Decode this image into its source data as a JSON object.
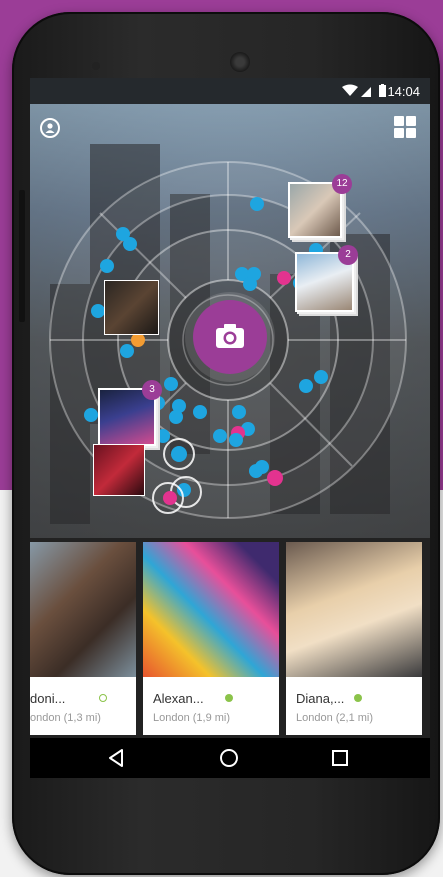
{
  "status_bar": {
    "time": "14:04"
  },
  "header": {
    "profile_icon": "profile-icon",
    "grid_icon": "grid-icon"
  },
  "clusters": [
    {
      "name": "cluster-top-right",
      "count": "12"
    },
    {
      "name": "cluster-right",
      "count": "2"
    },
    {
      "name": "cluster-left",
      "count": "3"
    }
  ],
  "camera_button": {
    "icon": "camera-icon"
  },
  "cards": [
    {
      "name": "doni...",
      "location": "ondon (1,3 mi)",
      "status_color": "#8bc34a",
      "online": false
    },
    {
      "name": "Alexan...",
      "location": "London (1,9 mi)",
      "status_color": "#8bc34a",
      "online": true
    },
    {
      "name": "Diana,...",
      "location": "London (2,1 mi)",
      "status_color": "#8bc34a",
      "online": true
    }
  ],
  "navigation": {
    "back": "back-icon",
    "home": "home-icon",
    "recents": "recents-icon"
  },
  "colors": {
    "accent": "#9b3d97",
    "dot_blue": "#1ea5e0",
    "dot_pink": "#e3338f",
    "dot_orange": "#f39c33"
  }
}
